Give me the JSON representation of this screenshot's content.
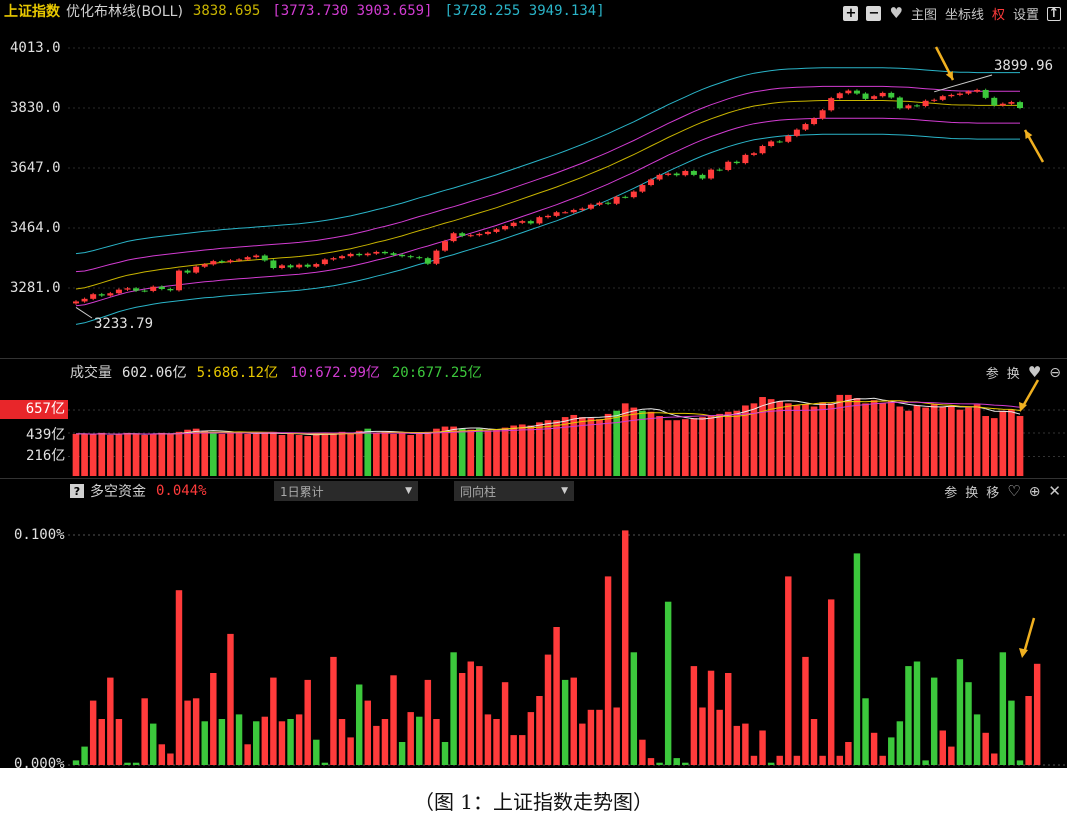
{
  "header": {
    "index_name": "上证指数",
    "indicator_name": "优化布林线(BOLL)",
    "value_mid": "3838.695",
    "value_band1": "[3773.730  3903.659]",
    "value_band2": "[3728.255  3949.134]",
    "tools": {
      "main": "主图",
      "axis": "坐标线",
      "right": "权",
      "settings": "设置"
    }
  },
  "price_axis": {
    "labels": [
      "4013.0",
      "3830.0",
      "3647.0",
      "3464.0",
      "3281.0"
    ]
  },
  "annotations": {
    "high": "3899.96",
    "low": "3233.79"
  },
  "volume_panel": {
    "title": "成交量",
    "total": "602.06亿",
    "ma5": "5:686.12亿",
    "ma10": "10:672.99亿",
    "ma20": "20:677.25亿",
    "tools": [
      "参",
      "换"
    ],
    "axis_labels": [
      "657亿",
      "439亿",
      "216亿"
    ]
  },
  "funds_panel": {
    "help": "?",
    "title": "多空资金",
    "value": "0.044%",
    "dropdown1": "1日累计",
    "dropdown2": "同向柱",
    "tools": [
      "参",
      "换",
      "移"
    ],
    "axis_labels": [
      "0.100%",
      "0.000%"
    ]
  },
  "caption": "（图 1：上证指数走势图）",
  "colors": {
    "up": "#ff3b3b",
    "down": "#3cc83c",
    "mid": "#c8b400",
    "band1": "#d23cd2",
    "band2": "#2ab4c8",
    "label_box": "#e8262a"
  },
  "icons": [
    "plus-box-icon",
    "minus-box-icon",
    "heart-icon",
    "arrow-up-box-icon",
    "heart-icon",
    "zoom-out-icon",
    "heart-outline-icon",
    "zoom-in-icon",
    "close-icon",
    "dropdown-arrow-icon"
  ],
  "chart_data": [
    {
      "type": "candlestick",
      "title": "上证指数 优化布林线(BOLL)",
      "ylim": [
        3170,
        4040
      ],
      "y_ticks": [
        4013.0,
        3830.0,
        3647.0,
        3464.0,
        3281.0
      ],
      "close": [
        3240,
        3248,
        3262,
        3258,
        3265,
        3276,
        3280,
        3273,
        3272,
        3285,
        3278,
        3274,
        3334,
        3328,
        3346,
        3353,
        3363,
        3360,
        3365,
        3368,
        3375,
        3380,
        3365,
        3342,
        3350,
        3344,
        3352,
        3346,
        3354,
        3368,
        3372,
        3378,
        3385,
        3381,
        3386,
        3391,
        3387,
        3382,
        3378,
        3375,
        3372,
        3355,
        3395,
        3424,
        3448,
        3440,
        3442,
        3446,
        3452,
        3460,
        3470,
        3480,
        3485,
        3478,
        3497,
        3501,
        3512,
        3512,
        3519,
        3523,
        3535,
        3541,
        3538,
        3559,
        3558,
        3575,
        3595,
        3612,
        3626,
        3630,
        3625,
        3638,
        3626,
        3615,
        3642,
        3641,
        3666,
        3662,
        3687,
        3692,
        3714,
        3728,
        3727,
        3745,
        3764,
        3781,
        3798,
        3823,
        3860,
        3875,
        3883,
        3874,
        3858,
        3866,
        3876,
        3862,
        3829,
        3838,
        3836,
        3852,
        3855,
        3866,
        3870,
        3874,
        3880,
        3885,
        3861,
        3838,
        3843,
        3848,
        3830
      ],
      "mid": [
        3278,
        3282,
        3289,
        3297,
        3305,
        3313,
        3320,
        3325,
        3330,
        3334,
        3338,
        3341,
        3345,
        3348,
        3351,
        3354,
        3356,
        3359,
        3361,
        3363,
        3365,
        3367,
        3369,
        3371,
        3373,
        3375,
        3377,
        3380,
        3383,
        3387,
        3391,
        3396,
        3401,
        3407,
        3413,
        3420,
        3426,
        3433,
        3440,
        3448,
        3456,
        3463,
        3471,
        3479,
        3486,
        3494,
        3502,
        3510,
        3518,
        3526,
        3535,
        3544,
        3553,
        3562,
        3571,
        3580,
        3589,
        3599,
        3609,
        3619,
        3630,
        3641,
        3652,
        3664,
        3676,
        3688,
        3701,
        3714,
        3727,
        3740,
        3752,
        3764,
        3776,
        3787,
        3797,
        3806,
        3815,
        3823,
        3830,
        3836,
        3840,
        3844,
        3847,
        3849,
        3850,
        3851,
        3852,
        3853,
        3853,
        3853,
        3853,
        3853,
        3853,
        3853,
        3853,
        3852,
        3851,
        3850,
        3848,
        3846,
        3844,
        3842,
        3840,
        3839,
        3839,
        3838,
        3838,
        3838,
        3838,
        3838,
        3838
      ],
      "band1_upper": [
        3331,
        3333,
        3339,
        3346,
        3353,
        3359,
        3366,
        3371,
        3375,
        3379,
        3382,
        3385,
        3388,
        3391,
        3394,
        3397,
        3399,
        3402,
        3404,
        3406,
        3408,
        3410,
        3412,
        3414,
        3416,
        3418,
        3420,
        3423,
        3426,
        3430,
        3434,
        3439,
        3444,
        3450,
        3456,
        3463,
        3469,
        3476,
        3483,
        3491,
        3499,
        3506,
        3514,
        3522,
        3529,
        3537,
        3545,
        3553,
        3561,
        3569,
        3578,
        3587,
        3596,
        3605,
        3614,
        3623,
        3632,
        3642,
        3652,
        3662,
        3673,
        3684,
        3695,
        3707,
        3719,
        3731,
        3744,
        3757,
        3770,
        3783,
        3795,
        3807,
        3819,
        3830,
        3840,
        3849,
        3858,
        3866,
        3873,
        3879,
        3883,
        3887,
        3890,
        3892,
        3893,
        3894,
        3895,
        3896,
        3896,
        3896,
        3896,
        3896,
        3896,
        3896,
        3896,
        3895,
        3894,
        3893,
        3891,
        3889,
        3887,
        3885,
        3883,
        3882,
        3882,
        3881,
        3881,
        3881,
        3881,
        3881,
        3881
      ],
      "band1_lower": [
        3227,
        3230,
        3237,
        3245,
        3253,
        3261,
        3268,
        3273,
        3278,
        3282,
        3285,
        3288,
        3291,
        3294,
        3297,
        3300,
        3302,
        3305,
        3307,
        3309,
        3311,
        3313,
        3315,
        3317,
        3319,
        3321,
        3323,
        3326,
        3329,
        3333,
        3337,
        3342,
        3347,
        3353,
        3359,
        3366,
        3372,
        3379,
        3386,
        3394,
        3402,
        3409,
        3417,
        3425,
        3432,
        3440,
        3448,
        3456,
        3464,
        3472,
        3481,
        3490,
        3499,
        3508,
        3517,
        3526,
        3535,
        3545,
        3555,
        3565,
        3576,
        3587,
        3598,
        3610,
        3622,
        3634,
        3647,
        3660,
        3673,
        3686,
        3698,
        3710,
        3722,
        3733,
        3743,
        3752,
        3761,
        3769,
        3776,
        3782,
        3786,
        3790,
        3793,
        3795,
        3796,
        3797,
        3798,
        3799,
        3799,
        3799,
        3799,
        3799,
        3799,
        3799,
        3799,
        3798,
        3797,
        3796,
        3794,
        3792,
        3790,
        3788,
        3786,
        3785,
        3785,
        3784,
        3784,
        3784,
        3784,
        3784,
        3784
      ],
      "band2_upper": [
        3386,
        3389,
        3395,
        3402,
        3409,
        3416,
        3423,
        3428,
        3432,
        3436,
        3439,
        3442,
        3445,
        3448,
        3451,
        3454,
        3456,
        3459,
        3461,
        3463,
        3465,
        3467,
        3469,
        3471,
        3473,
        3475,
        3477,
        3480,
        3483,
        3487,
        3491,
        3496,
        3501,
        3507,
        3513,
        3520,
        3526,
        3533,
        3540,
        3548,
        3556,
        3563,
        3571,
        3579,
        3586,
        3594,
        3602,
        3610,
        3618,
        3626,
        3635,
        3644,
        3653,
        3662,
        3671,
        3680,
        3689,
        3699,
        3709,
        3719,
        3730,
        3741,
        3752,
        3764,
        3776,
        3788,
        3801,
        3814,
        3827,
        3840,
        3852,
        3864,
        3876,
        3887,
        3897,
        3906,
        3915,
        3923,
        3930,
        3936,
        3940,
        3944,
        3947,
        3949,
        3950,
        3951,
        3952,
        3953,
        3953,
        3953,
        3953,
        3953,
        3953,
        3953,
        3953,
        3952,
        3951,
        3950,
        3948,
        3946,
        3944,
        3942,
        3940,
        3939,
        3939,
        3938,
        3938,
        3938,
        3938,
        3938,
        3938
      ],
      "band2_lower": [
        3170,
        3175,
        3183,
        3191,
        3200,
        3209,
        3216,
        3222,
        3227,
        3232,
        3236,
        3239,
        3242,
        3245,
        3248,
        3251,
        3253,
        3256,
        3258,
        3260,
        3262,
        3264,
        3266,
        3268,
        3270,
        3272,
        3274,
        3277,
        3280,
        3284,
        3288,
        3293,
        3298,
        3304,
        3310,
        3317,
        3323,
        3330,
        3337,
        3345,
        3353,
        3360,
        3368,
        3376,
        3383,
        3391,
        3399,
        3407,
        3415,
        3423,
        3432,
        3441,
        3450,
        3459,
        3468,
        3477,
        3486,
        3496,
        3506,
        3516,
        3527,
        3538,
        3549,
        3561,
        3573,
        3585,
        3598,
        3611,
        3624,
        3637,
        3649,
        3661,
        3673,
        3684,
        3694,
        3703,
        3712,
        3720,
        3727,
        3733,
        3737,
        3741,
        3744,
        3746,
        3747,
        3748,
        3749,
        3750,
        3750,
        3750,
        3750,
        3750,
        3750,
        3750,
        3750,
        3749,
        3748,
        3747,
        3745,
        3743,
        3741,
        3739,
        3737,
        3736,
        3736,
        3735,
        3735,
        3735,
        3735,
        3735,
        3735
      ]
    },
    {
      "type": "bar",
      "title": "成交量",
      "unit": "亿",
      "y_ticks": [
        657,
        439,
        216
      ],
      "values": [
        430,
        430,
        425,
        440,
        420,
        430,
        440,
        430,
        420,
        430,
        440,
        430,
        450,
        470,
        480,
        460,
        450,
        430,
        440,
        440,
        430,
        430,
        440,
        450,
        420,
        430,
        420,
        410,
        430,
        440,
        430,
        450,
        440,
        460,
        480,
        440,
        450,
        430,
        440,
        420,
        430,
        450,
        480,
        500,
        500,
        480,
        470,
        480,
        460,
        470,
        490,
        510,
        520,
        510,
        540,
        560,
        560,
        590,
        610,
        590,
        580,
        570,
        620,
        650,
        720,
        680,
        650,
        640,
        600,
        560,
        560,
        570,
        580,
        590,
        600,
        620,
        640,
        650,
        700,
        720,
        780,
        760,
        740,
        720,
        700,
        710,
        690,
        730,
        720,
        800,
        800,
        770,
        720,
        750,
        720,
        740,
        690,
        650,
        700,
        680,
        710,
        690,
        690,
        660,
        680,
        710,
        600,
        580,
        650,
        660,
        600
      ],
      "direction": [
        "up",
        "up",
        "up",
        "up",
        "up",
        "up",
        "up",
        "up",
        "up",
        "up",
        "up",
        "up",
        "up",
        "up",
        "up",
        "up",
        "down",
        "up",
        "up",
        "up",
        "up",
        "up",
        "up",
        "up",
        "up",
        "up",
        "up",
        "up",
        "up",
        "up",
        "up",
        "up",
        "up",
        "up",
        "down",
        "up",
        "up",
        "up",
        "up",
        "up",
        "up",
        "up",
        "up",
        "up",
        "up",
        "down",
        "up",
        "down",
        "up",
        "up",
        "up",
        "up",
        "up",
        "up",
        "up",
        "up",
        "up",
        "up",
        "up",
        "up",
        "up",
        "up",
        "up",
        "down",
        "up",
        "up",
        "down",
        "up",
        "up",
        "up",
        "up",
        "up",
        "up",
        "up",
        "up",
        "up",
        "up",
        "up",
        "up",
        "up",
        "up",
        "up",
        "up",
        "up",
        "up",
        "up",
        "up",
        "up",
        "up",
        "up",
        "up",
        "up",
        "up",
        "up",
        "up",
        "up",
        "up",
        "up",
        "up",
        "up",
        "up",
        "up",
        "up",
        "up",
        "up",
        "up",
        "up",
        "up",
        "up",
        "up",
        "up",
        "up",
        "up",
        "up",
        "up",
        "up",
        "up",
        "up",
        "up",
        "up"
      ]
    },
    {
      "type": "bar",
      "title": "多空资金",
      "unit": "%",
      "y_ticks": [
        0.1,
        0.0
      ],
      "values": [
        0.002,
        0.008,
        0.028,
        0.02,
        0.038,
        0.02,
        0.001,
        0.001,
        0.029,
        0.018,
        0.009,
        0.005,
        0.076,
        0.028,
        0.029,
        0.019,
        0.04,
        0.02,
        0.057,
        0.022,
        0.009,
        0.019,
        0.021,
        0.038,
        0.019,
        0.02,
        0.022,
        0.037,
        0.011,
        0.001,
        0.047,
        0.02,
        0.012,
        0.035,
        0.028,
        0.017,
        0.02,
        0.039,
        0.01,
        0.023,
        0.021,
        0.037,
        0.02,
        0.01,
        0.049,
        0.04,
        0.045,
        0.043,
        0.022,
        0.02,
        0.036,
        0.013,
        0.013,
        0.023,
        0.03,
        0.048,
        0.06,
        0.037,
        0.038,
        0.018,
        0.024,
        0.024,
        0.082,
        0.025,
        0.102,
        0.049,
        0.011,
        0.003,
        0.001,
        0.071,
        0.003,
        0.001,
        0.043,
        0.025,
        0.041,
        0.024,
        0.04,
        0.017,
        0.018,
        0.004,
        0.015,
        0.001,
        0.004,
        0.082,
        0.004,
        0.047,
        0.02,
        0.004,
        0.072,
        0.004,
        0.01,
        0.092,
        0.029,
        0.014,
        0.004,
        0.012,
        0.019,
        0.043,
        0.045,
        0.002,
        0.038,
        0.015,
        0.008,
        0.046,
        0.036,
        0.022,
        0.014,
        0.005,
        0.049,
        0.028,
        0.002,
        0.03,
        0.044
      ],
      "direction": [
        "down",
        "down",
        "up",
        "up",
        "up",
        "up",
        "down",
        "down",
        "up",
        "down",
        "up",
        "up",
        "up",
        "up",
        "up",
        "down",
        "up",
        "down",
        "up",
        "down",
        "up",
        "down",
        "up",
        "up",
        "up",
        "down",
        "up",
        "up",
        "down",
        "down",
        "up",
        "up",
        "up",
        "down",
        "up",
        "up",
        "up",
        "up",
        "down",
        "up",
        "down",
        "up",
        "up",
        "down",
        "down",
        "up",
        "up",
        "up",
        "up",
        "up",
        "up",
        "up",
        "up",
        "up",
        "up",
        "up",
        "up",
        "down",
        "up",
        "up",
        "up",
        "up",
        "up",
        "up",
        "up",
        "down",
        "up",
        "up",
        "down",
        "down",
        "down",
        "down",
        "up",
        "up",
        "up",
        "up",
        "up",
        "up",
        "up",
        "up",
        "up",
        "down",
        "up",
        "up",
        "up",
        "up",
        "up",
        "up",
        "up",
        "up",
        "up",
        "down",
        "down",
        "up",
        "up",
        "down",
        "down",
        "down",
        "down",
        "down",
        "down",
        "up",
        "up",
        "down",
        "down",
        "down",
        "up",
        "up",
        "down",
        "down",
        "down",
        "up",
        "up"
      ]
    }
  ]
}
